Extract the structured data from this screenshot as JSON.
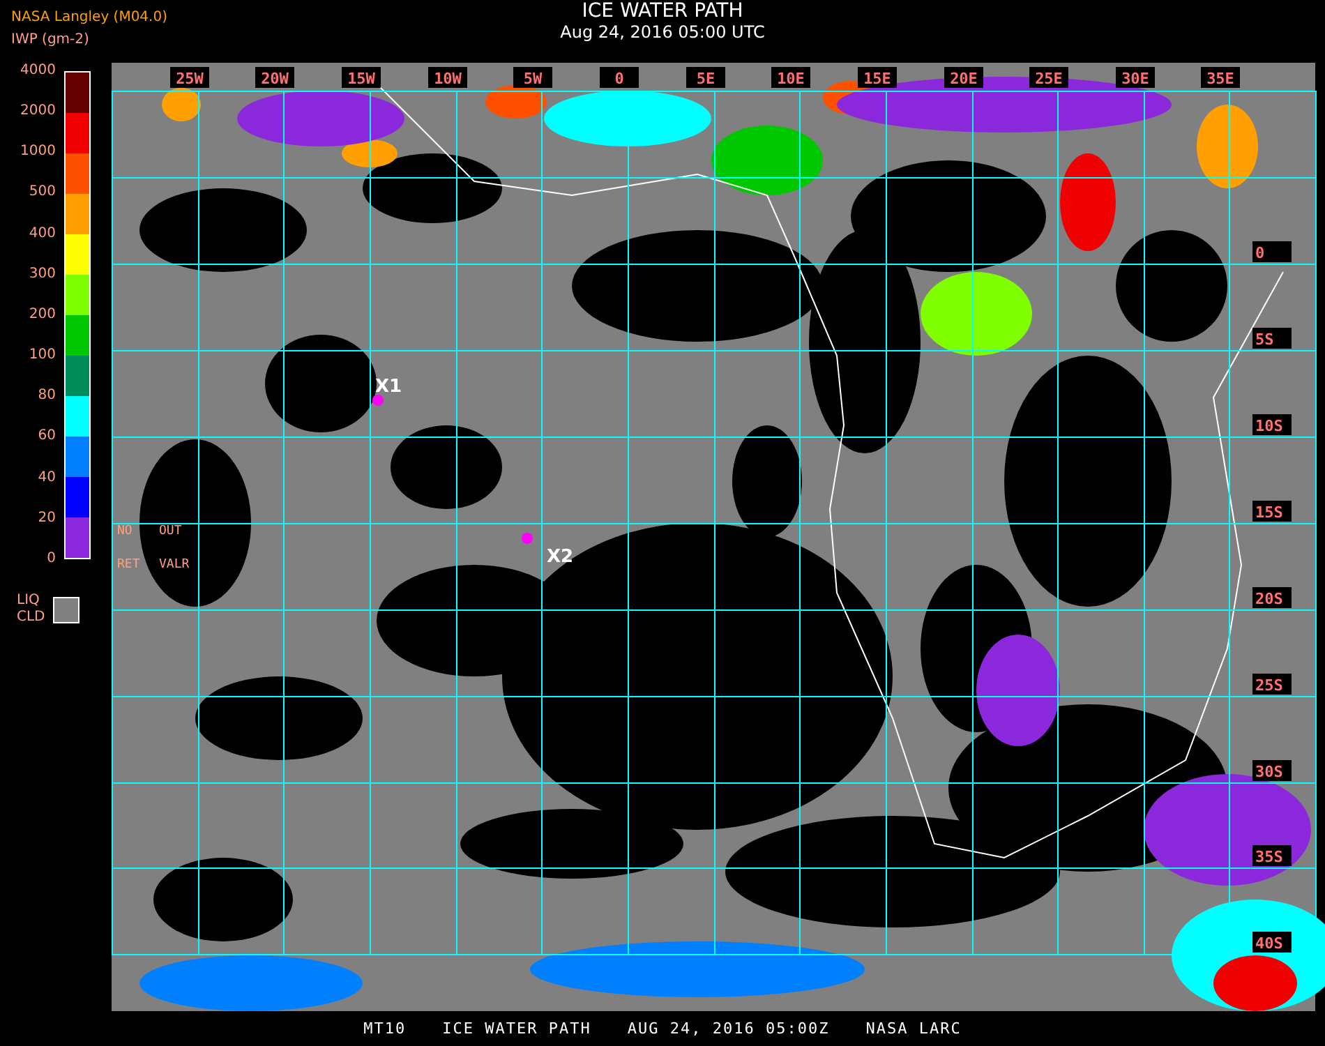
{
  "header": {
    "source": "NASA Langley (M04.0)",
    "units": "IWP (gm-2)",
    "title": "ICE WATER PATH",
    "subtitle": "Aug 24, 2016 05:00 UTC"
  },
  "legend": {
    "ticks": [
      "4000",
      "2000",
      "1000",
      "500",
      "400",
      "300",
      "200",
      "100",
      "80",
      "60",
      "40",
      "20",
      "0"
    ],
    "bands": [
      {
        "color": "#640000"
      },
      {
        "color": "#f00000"
      },
      {
        "color": "#ff5000"
      },
      {
        "color": "#ffa000"
      },
      {
        "color": "#ffff00"
      },
      {
        "color": "#80ff00"
      },
      {
        "color": "#00c800"
      },
      {
        "color": "#008c5a"
      },
      {
        "color": "#00ffff"
      },
      {
        "color": "#0080ff"
      },
      {
        "color": "#0000ff"
      },
      {
        "color": "#8c28dc"
      }
    ],
    "liquid": {
      "lines": [
        "LIQ",
        "CLD"
      ],
      "color": "#808080"
    }
  },
  "map": {
    "lon_labels": [
      "25W",
      "20W",
      "15W",
      "10W",
      "5W",
      "0",
      "5E",
      "10E",
      "15E",
      "20E",
      "25E",
      "30E",
      "35E"
    ],
    "lat_labels": [
      "0",
      "5S",
      "10S",
      "15S",
      "20S",
      "25S",
      "30S",
      "35S",
      "40S"
    ],
    "notes": [
      [
        "NO",
        "OUT"
      ],
      [
        "RET",
        "VALR"
      ]
    ],
    "markers": [
      {
        "label": "X1"
      },
      {
        "label": "X2"
      }
    ]
  },
  "footer": [
    "MT10",
    "ICE WATER PATH",
    "AUG 24, 2016 05:00Z",
    "NASA LARC"
  ]
}
